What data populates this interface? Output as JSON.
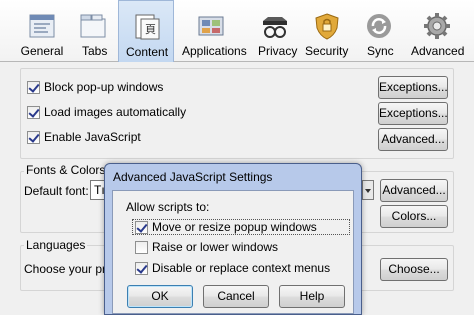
{
  "toolbar": {
    "items": [
      {
        "label": "General",
        "icon": "general-icon"
      },
      {
        "label": "Tabs",
        "icon": "tabs-icon"
      },
      {
        "label": "Content",
        "icon": "content-icon",
        "active": true
      },
      {
        "label": "Applications",
        "icon": "applications-icon"
      },
      {
        "label": "Privacy",
        "icon": "privacy-icon"
      },
      {
        "label": "Security",
        "icon": "security-icon"
      },
      {
        "label": "Sync",
        "icon": "sync-icon"
      },
      {
        "label": "Advanced",
        "icon": "advanced-icon"
      }
    ]
  },
  "content": {
    "block_popups": {
      "label": "Block pop-up windows",
      "checked": true,
      "button": "Exceptions..."
    },
    "load_images": {
      "label": "Load images automatically",
      "checked": true,
      "button": "Exceptions..."
    },
    "enable_js": {
      "label": "Enable JavaScript",
      "checked": true,
      "button": "Advanced..."
    },
    "fonts": {
      "heading": "Fonts & Colors",
      "default_font_label": "Default font:",
      "default_font_value": "Tı",
      "advanced_button": "Advanced...",
      "colors_button": "Colors..."
    },
    "languages": {
      "heading": "Languages",
      "text": "Choose your prefe",
      "choose_button": "Choose..."
    }
  },
  "dialog": {
    "title": "Advanced JavaScript Settings",
    "prompt": "Allow scripts to:",
    "options": [
      {
        "label": "Move or resize popup windows",
        "checked": true
      },
      {
        "label": "Raise or lower windows",
        "checked": false
      },
      {
        "label": "Disable or replace context menus",
        "checked": true
      }
    ],
    "ok": "OK",
    "cancel": "Cancel",
    "help": "Help"
  },
  "colors": {
    "dialog_frame": "#b7c9ea",
    "active_tab": "#c3d8f1"
  }
}
